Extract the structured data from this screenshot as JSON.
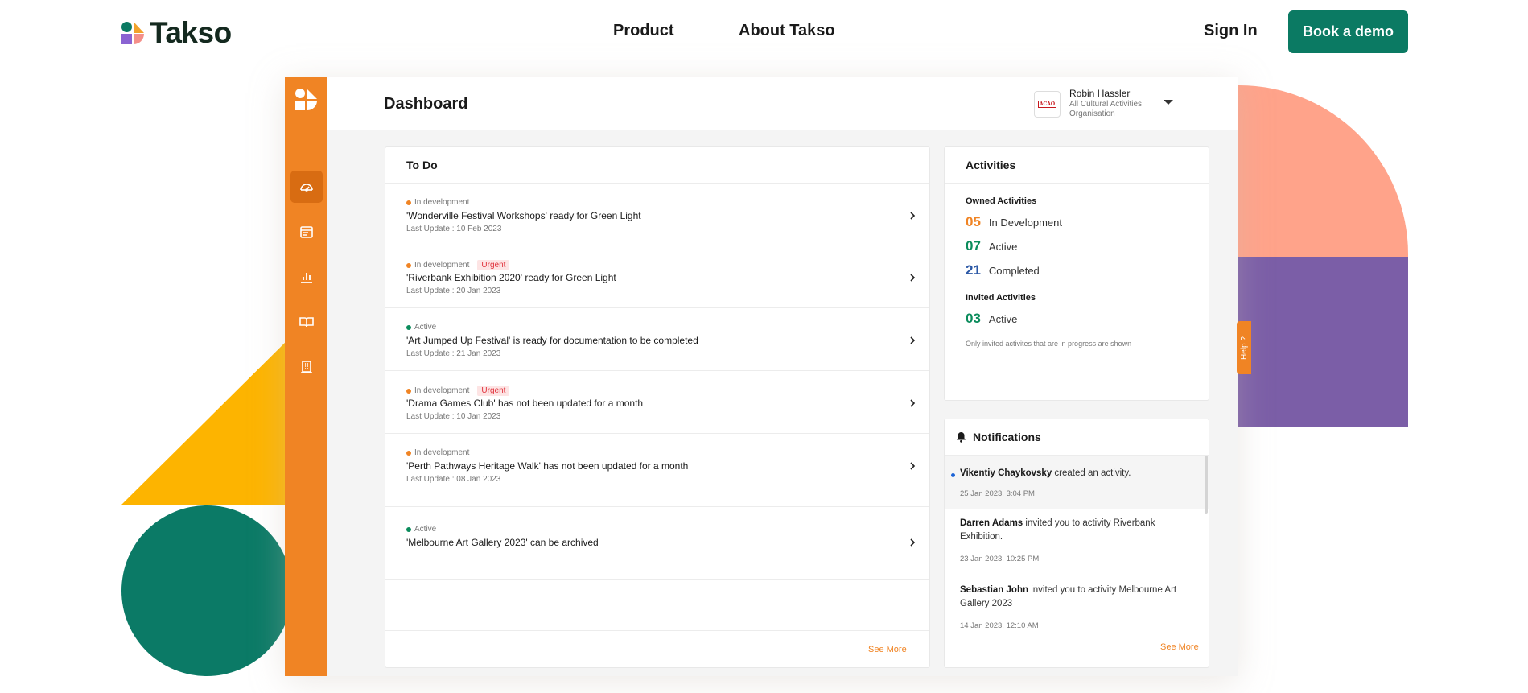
{
  "site": {
    "logo_text": "Takso",
    "nav": {
      "product": "Product",
      "about": "About Takso"
    },
    "sign_in": "Sign In",
    "book_demo": "Book a demo"
  },
  "colors": {
    "brand_green": "#0b7a63",
    "sidebar_orange": "#f08424",
    "urgent_red": "#e0303a",
    "in_dev_orange": "#f08424",
    "active_green": "#0b8c5c",
    "completed_blue": "#2a57a5"
  },
  "app": {
    "page_title": "Dashboard",
    "user": {
      "name": "Robin Hassler",
      "org": "All Cultural Activities Organisation",
      "avatar_text": "ACAO"
    },
    "sidebar": [
      {
        "name": "dashboard-icon"
      },
      {
        "name": "calendar-icon"
      },
      {
        "name": "chart-icon"
      },
      {
        "name": "book-icon"
      },
      {
        "name": "building-icon"
      }
    ],
    "help_label": "Help ?"
  },
  "todo": {
    "title": "To Do",
    "see_more": "See More",
    "items": [
      {
        "status": "In development",
        "urgent": "",
        "title": "'Wonderville Festival Workshops' ready for Green Light",
        "update": "Last Update : 10 Feb 2023"
      },
      {
        "status": "In development",
        "urgent": "Urgent",
        "title": "'Riverbank Exhibition 2020' ready for Green Light",
        "update": "Last Update : 20 Jan 2023"
      },
      {
        "status": "Active",
        "urgent": "",
        "title": "'Art Jumped Up Festival' is ready for documentation to be completed",
        "update": "Last Update : 21 Jan 2023"
      },
      {
        "status": "In development",
        "urgent": "Urgent",
        "title": "'Drama Games Club' has not been updated for a month",
        "update": "Last Update : 10 Jan 2023"
      },
      {
        "status": "In development",
        "urgent": "",
        "title": "'Perth Pathways Heritage Walk' has not been updated for a month",
        "update": "Last Update : 08 Jan 2023"
      },
      {
        "status": "Active",
        "urgent": "",
        "title": "'Melbourne Art Gallery 2023' can be archived",
        "update": ""
      }
    ]
  },
  "activities": {
    "title": "Activities",
    "owned_title": "Owned Activities",
    "owned": [
      {
        "count": "05",
        "label": "In Development"
      },
      {
        "count": "07",
        "label": "Active"
      },
      {
        "count": "21",
        "label": "Completed"
      }
    ],
    "invited_title": "Invited Activities",
    "invited": [
      {
        "count": "03",
        "label": "Active"
      }
    ],
    "note": "Only invited activites that are in progress are shown"
  },
  "notifications": {
    "title": "Notifications",
    "see_more": "See More",
    "items": [
      {
        "actor": "Vikentiy Chaykovsky",
        "text": " created an activity.",
        "time": "25 Jan 2023, 3:04 PM"
      },
      {
        "actor": "Darren Adams",
        "text": " invited you to activity Riverbank Exhibition.",
        "time": "23 Jan 2023, 10:25 PM"
      },
      {
        "actor": "Sebastian John",
        "text": " invited you to activity Melbourne Art Gallery 2023",
        "time": "14 Jan 2023, 12:10 AM"
      }
    ]
  }
}
